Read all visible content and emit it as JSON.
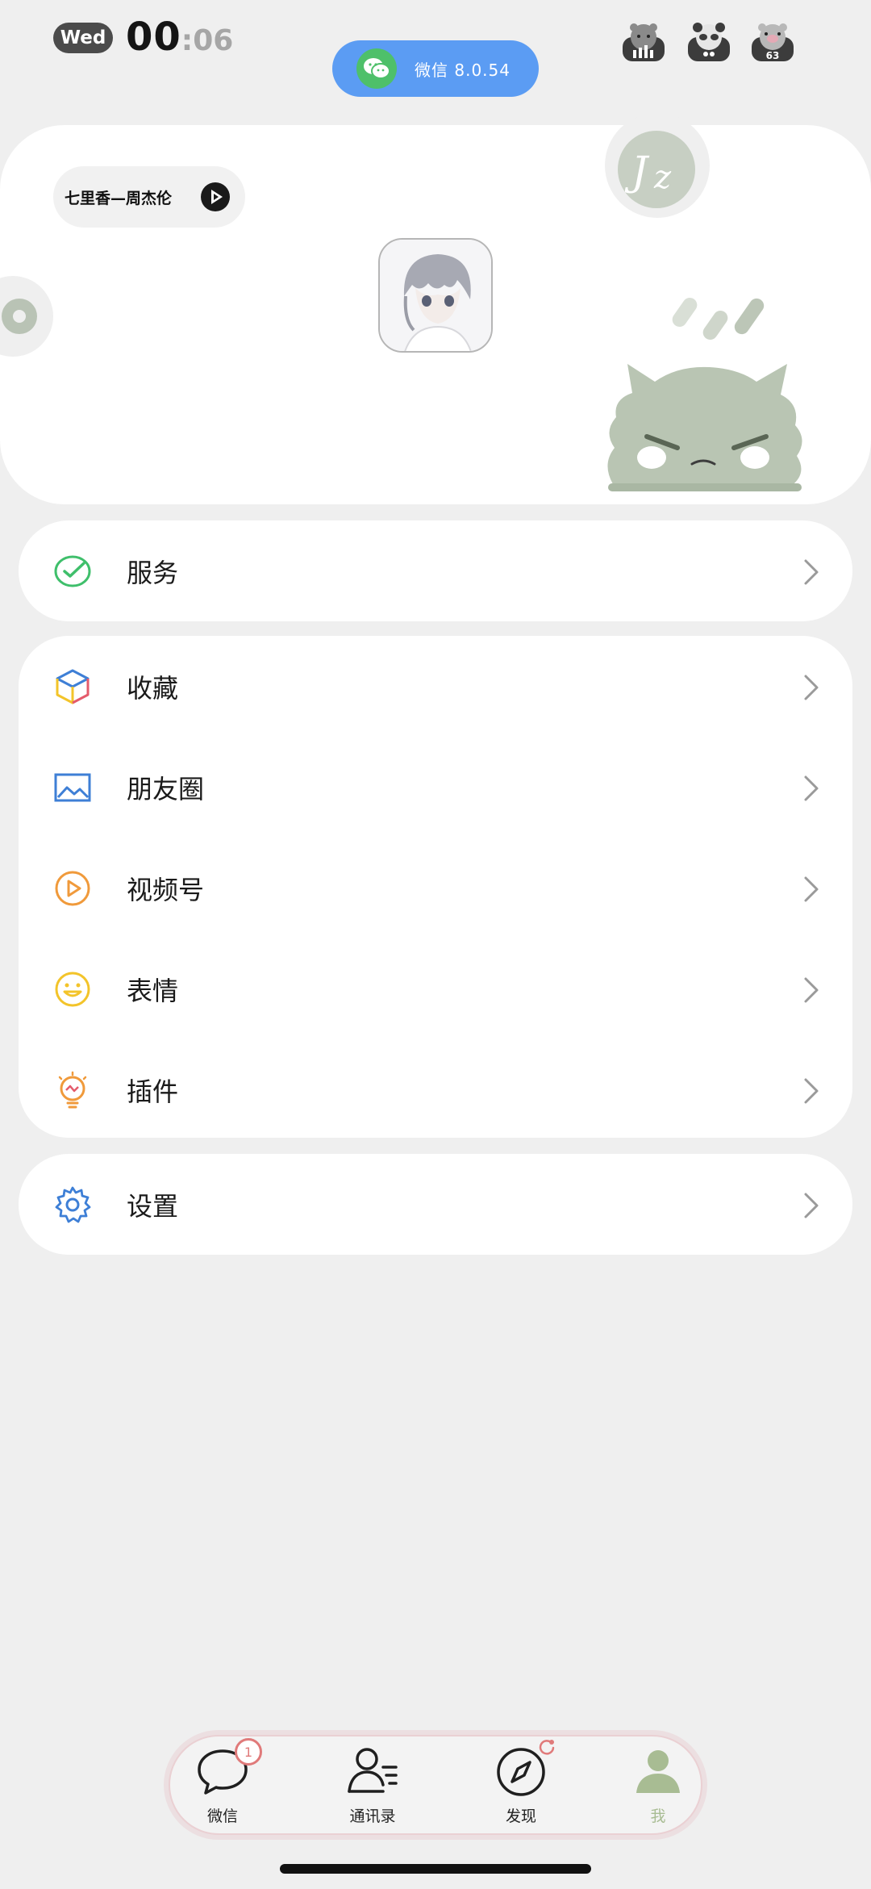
{
  "status_bar": {
    "day": "Wed",
    "time_hours": "00",
    "time_minutes": ":06",
    "island_text": "微信 8.0.54",
    "battery_label": "63"
  },
  "profile": {
    "music_title": "七里香—周杰伦"
  },
  "menu": {
    "services": {
      "label": "服务",
      "icon": "wechat-pay-check-icon",
      "color": "#3fbf6b"
    },
    "favorites": {
      "label": "收藏",
      "icon": "cube-icon"
    },
    "moments": {
      "label": "朋友圈",
      "icon": "picture-icon",
      "color": "#3e7fd6"
    },
    "channels": {
      "label": "视频号",
      "icon": "play-circle-icon",
      "color": "#f09a3b"
    },
    "stickers": {
      "label": "表情",
      "icon": "smiley-icon",
      "color": "#f3c42a"
    },
    "plugins": {
      "label": "插件",
      "icon": "light-bulb-icon",
      "color": "#f09a3b"
    },
    "settings": {
      "label": "设置",
      "icon": "gear-icon",
      "color": "#3e7fd6"
    }
  },
  "tabbar": {
    "tabs": [
      {
        "label": "微信",
        "icon": "chat-bubble-icon",
        "badge": "1"
      },
      {
        "label": "通讯录",
        "icon": "contacts-icon"
      },
      {
        "label": "发现",
        "icon": "compass-icon"
      },
      {
        "label": "我",
        "icon": "person-icon",
        "active": true
      }
    ]
  }
}
